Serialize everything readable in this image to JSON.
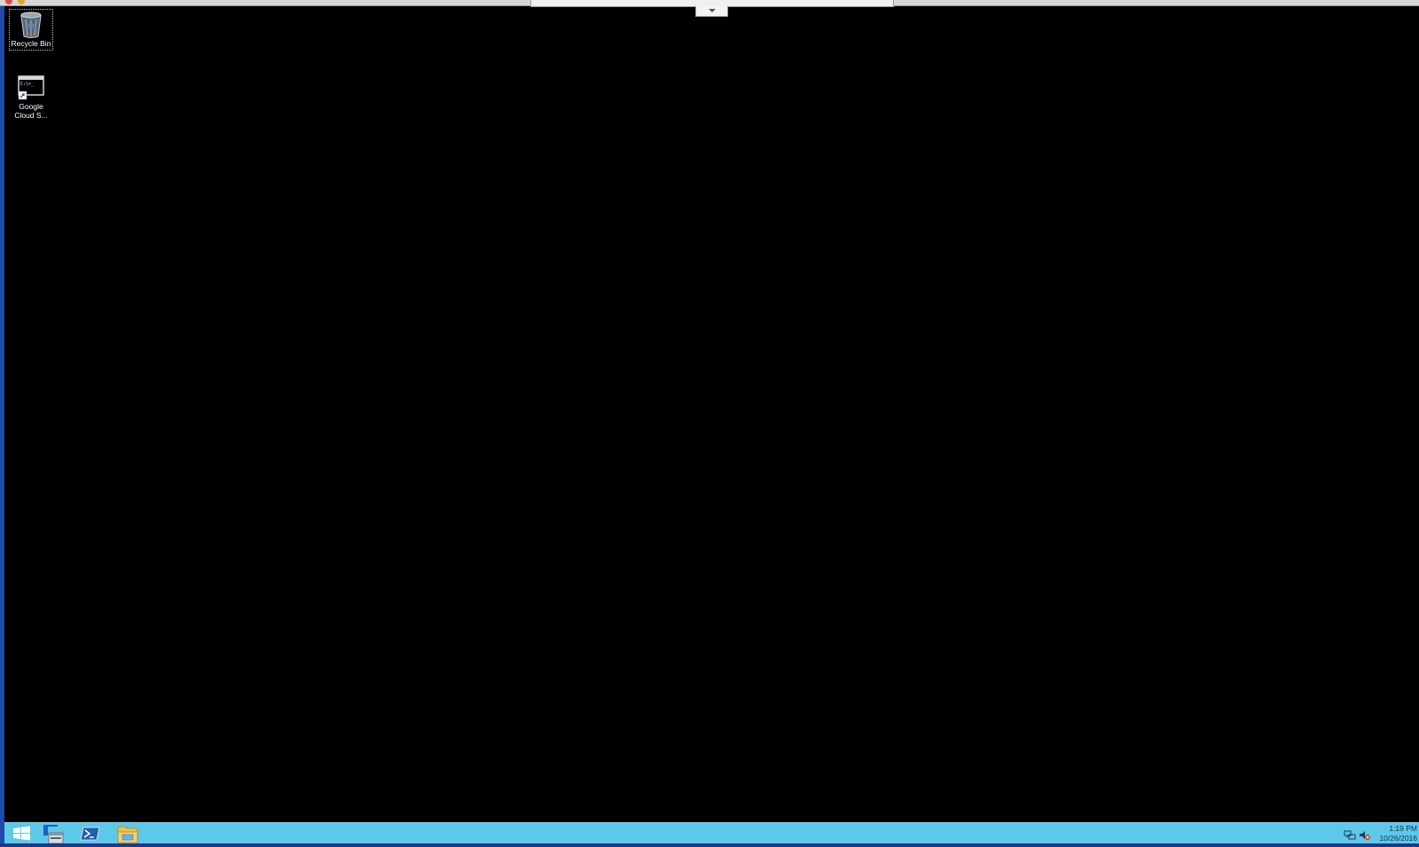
{
  "desktop": {
    "icons": [
      {
        "label": "Recycle Bin",
        "icon": "recycle-bin-icon"
      },
      {
        "label_line1": "Google",
        "label_line2": "Cloud S...",
        "icon": "command-prompt-shortcut-icon",
        "console_text": "C:\\>_"
      }
    ]
  },
  "taskbar": {
    "pinned": [
      {
        "name": "Start",
        "icon": "windows-logo-icon"
      },
      {
        "name": "Server Manager",
        "icon": "server-manager-icon"
      },
      {
        "name": "Windows PowerShell",
        "icon": "powershell-icon"
      },
      {
        "name": "File Explorer",
        "icon": "file-explorer-icon"
      }
    ],
    "tray": {
      "network_icon": "network-icon",
      "sound_icon": "sound-muted-icon"
    },
    "clock": {
      "time": "1:19 PM",
      "date": "10/26/2016"
    }
  },
  "colors": {
    "taskbar": "#5ec8e8",
    "desktop": "#000000",
    "host_edge": "#1f4aa8"
  }
}
